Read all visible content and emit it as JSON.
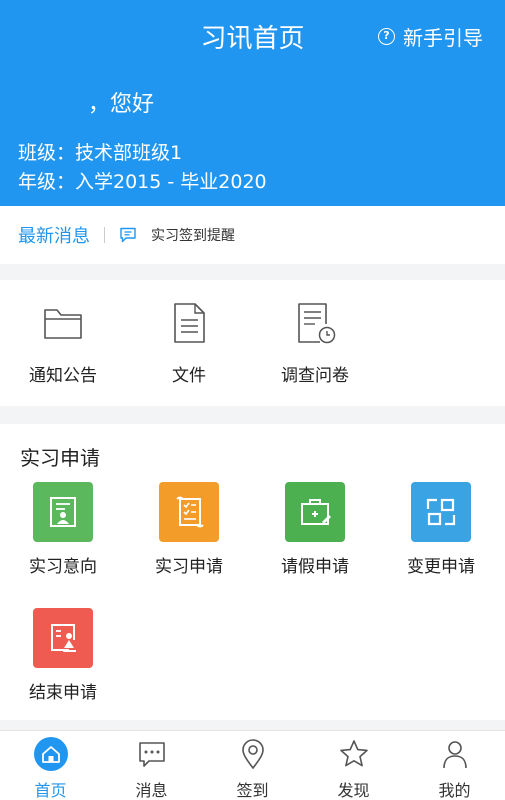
{
  "header": {
    "title": "习讯首页",
    "guide_label": "新手引导",
    "guide_icon": "?",
    "greeting": "，您好",
    "class_line": "班级：技术部班级1",
    "grade_line": "年级：入学2015 - 毕业2020"
  },
  "news": {
    "title": "最新消息",
    "text": "实习签到提醒"
  },
  "quick_links": [
    {
      "label": "通知公告",
      "icon": "folder-icon"
    },
    {
      "label": "文件",
      "icon": "document-icon"
    },
    {
      "label": "调查问卷",
      "icon": "survey-icon"
    }
  ],
  "apply_section": {
    "title": "实习申请",
    "items": [
      {
        "label": "实习意向",
        "icon": "intention-icon",
        "color": "#5cb85c"
      },
      {
        "label": "实习申请",
        "icon": "scroll-icon",
        "color": "#f39c2a"
      },
      {
        "label": "请假申请",
        "icon": "medical-kit-icon",
        "color": "#4caf50"
      },
      {
        "label": "变更申请",
        "icon": "change-icon",
        "color": "#3aa3e3"
      },
      {
        "label": "结束申请",
        "icon": "end-icon",
        "color": "#ef5b50"
      }
    ]
  },
  "tabbar": {
    "items": [
      {
        "label": "首页",
        "icon": "home-icon",
        "active": true
      },
      {
        "label": "消息",
        "icon": "message-icon",
        "active": false
      },
      {
        "label": "签到",
        "icon": "location-icon",
        "active": false
      },
      {
        "label": "发现",
        "icon": "star-icon",
        "active": false
      },
      {
        "label": "我的",
        "icon": "user-icon",
        "active": false
      }
    ]
  },
  "colors": {
    "primary": "#2196f0",
    "background": "#f2f4f6"
  }
}
